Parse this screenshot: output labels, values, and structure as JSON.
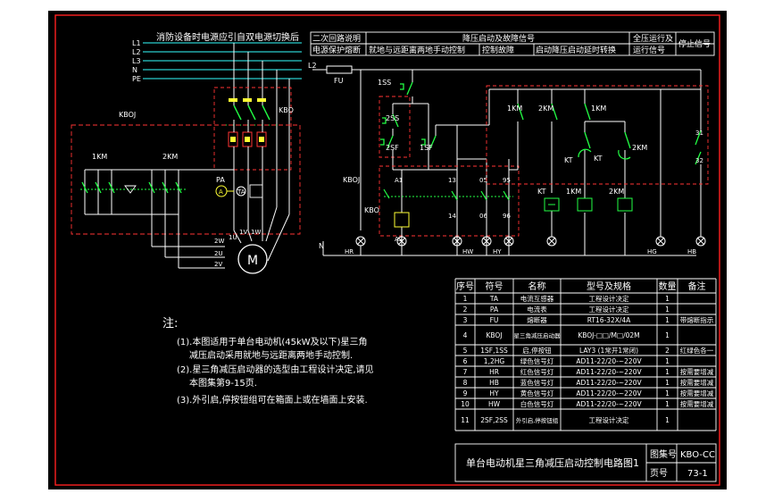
{
  "colors": {
    "background": "#000000",
    "frame": "#ff2020",
    "line_white": "#ffffff",
    "cyan": "#33ffff",
    "green": "#22ff44",
    "yellow": "#ffff33",
    "red_dashed": "#ff3333",
    "table_text": "#ffffff"
  },
  "left_circuit": {
    "title": "消防设备时电源应引自双电源切换后",
    "bus_labels": [
      "L1",
      "L2",
      "L3",
      "N",
      "PE"
    ],
    "qf_label": "KBO",
    "assembly_label": "KBOJ",
    "contactor_1": "1KM",
    "contactor_2": "2KM",
    "pa_label": "PA",
    "ta_label": "TA",
    "motor_label": "M",
    "motor_terminals": [
      "1U",
      "1V",
      "1W",
      "2W",
      "2U",
      "2V"
    ]
  },
  "top_header": {
    "row1": [
      "二次回路说明",
      "降压启动及故障信号",
      "全压运行及",
      "停止信号"
    ],
    "row2": [
      "电源保护熔断",
      "就地与远距离两地手动控制",
      "控制故障",
      "启动降压启动延时转换",
      "运行信号"
    ]
  },
  "right_circuit": {
    "l2": "L2",
    "fu": "FU",
    "n": "N",
    "ss1": "1SS",
    "ss2": "2SS",
    "sf2": "2SF",
    "sf1": "1SF",
    "kboj": "KBOJ",
    "kbo": "KBO",
    "a1": "A1",
    "a2": "A2",
    "terminals": [
      "13",
      "14",
      "05",
      "06",
      "95",
      "96"
    ],
    "contacts": [
      "1KM",
      "2KM",
      "1KM",
      "2KM",
      "31",
      "32",
      "KT",
      "KT"
    ],
    "coils": [
      "KT",
      "1KM",
      "2KM"
    ],
    "lamps": [
      "HR",
      "HW",
      "HY",
      "HG",
      "HB"
    ]
  },
  "notes": {
    "title": "注:",
    "lines": [
      "(1).本图适用于单台电动机(45kW及以下)星三角",
      "减压启动采用就地与远距离两地手动控制.",
      "(2).星三角减压启动器的选型由工程设计决定,请见",
      "本图集第9-15页.",
      "(3).外引启,停按钮组可在箱面上或在墙面上安装."
    ]
  },
  "table": {
    "headers": [
      "序号",
      "符号",
      "名称",
      "型号及规格",
      "数量",
      "备注"
    ],
    "rows": [
      [
        "1",
        "TA",
        "电流互感器",
        "工程设计决定",
        "1",
        ""
      ],
      [
        "2",
        "PA",
        "电流表",
        "工程设计决定",
        "1",
        ""
      ],
      [
        "3",
        "FU",
        "熔断器",
        "RT16-32X/4A",
        "1",
        "带熔断指示"
      ],
      [
        "4",
        "KBOJ",
        "星三角减压启动器",
        "KBOJ-□□/M□/02M",
        "1",
        ""
      ],
      [
        "5",
        "1SF,1SS",
        "启,停按钮",
        "LAY3 (1常开1常闭)",
        "2",
        "红绿色各一"
      ],
      [
        "6",
        "1,2HG",
        "绿色信号灯",
        "AD11-22/20-~220V",
        "1",
        ""
      ],
      [
        "7",
        "HR",
        "红色信号灯",
        "AD11-22/20-~220V",
        "1",
        "按需要增减"
      ],
      [
        "8",
        "HB",
        "蓝色信号灯",
        "AD11-22/20-~220V",
        "1",
        "按需要增减"
      ],
      [
        "9",
        "HY",
        "黄色信号灯",
        "AD11-22/20-~220V",
        "1",
        "按需要增减"
      ],
      [
        "10",
        "HW",
        "白色信号灯",
        "AD11-22/20-~220V",
        "1",
        "按需要增减"
      ],
      [
        "11",
        "2SF,2SS",
        "外引启,停按钮组",
        "工程设计决定",
        "1",
        ""
      ]
    ]
  },
  "title_block": {
    "title": "单台电动机星三角减压启动控制电路图1",
    "atlas_label": "图集号",
    "atlas_value": "KBO-CC",
    "page_label": "页号",
    "page_value": "73-1"
  }
}
